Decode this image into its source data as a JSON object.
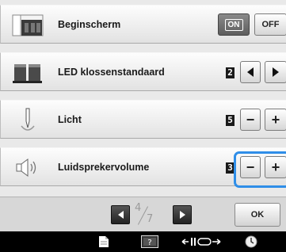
{
  "rows": [
    {
      "label": "Beginscherm",
      "icon": "home-screen-icon",
      "control": "toggle",
      "on_label": "ON",
      "off_label": "OFF",
      "selected": "ON"
    },
    {
      "label": "LED klossenstandaard",
      "icon": "spool-stand-led-icon",
      "control": "arrows",
      "value": "2"
    },
    {
      "label": "Licht",
      "icon": "needle-light-icon",
      "control": "stepper",
      "value": "5",
      "minus": "−",
      "plus": "+"
    },
    {
      "label": "Luidsprekervolume",
      "icon": "speaker-icon",
      "control": "stepper",
      "value": "3",
      "minus": "−",
      "plus": "+"
    }
  ],
  "footer": {
    "page_current": "4",
    "page_total": "7",
    "ok_label": "OK"
  },
  "taskbar": {
    "items": [
      "page-icon",
      "settings-icon",
      "presser-foot-icon",
      "clock-icon"
    ]
  },
  "colors": {
    "highlight": "#2f8ee8"
  }
}
